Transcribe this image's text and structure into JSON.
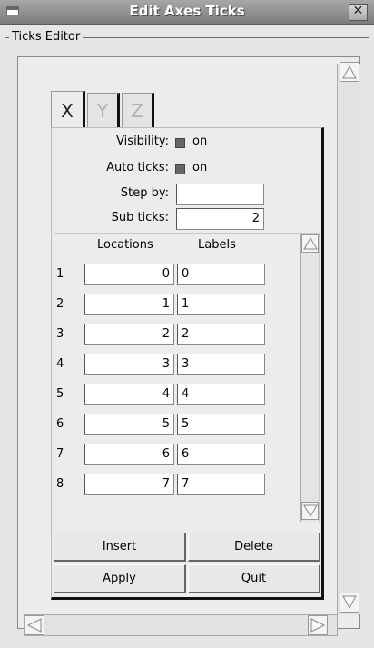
{
  "window": {
    "title": "Edit Axes Ticks",
    "close_glyph": "✕"
  },
  "frame": {
    "legend": "Ticks Editor"
  },
  "tabs": [
    {
      "label": "X",
      "active": true
    },
    {
      "label": "Y",
      "active": false
    },
    {
      "label": "Z",
      "active": false
    }
  ],
  "settings": {
    "visibility_label": "Visibility:",
    "visibility_value": "on",
    "auto_ticks_label": "Auto ticks:",
    "auto_ticks_value": "on",
    "step_by_label": "Step by:",
    "step_by_value": "",
    "sub_ticks_label": "Sub ticks:",
    "sub_ticks_value": "2"
  },
  "table": {
    "headers": {
      "locations": "Locations",
      "labels": "Labels"
    },
    "rows": [
      {
        "index": "1",
        "location": "0",
        "label": "0"
      },
      {
        "index": "2",
        "location": "1",
        "label": "1"
      },
      {
        "index": "3",
        "location": "2",
        "label": "2"
      },
      {
        "index": "4",
        "location": "3",
        "label": "3"
      },
      {
        "index": "5",
        "location": "4",
        "label": "4"
      },
      {
        "index": "6",
        "location": "5",
        "label": "5"
      },
      {
        "index": "7",
        "location": "6",
        "label": "6"
      },
      {
        "index": "8",
        "location": "7",
        "label": "7"
      }
    ]
  },
  "buttons": {
    "insert": "Insert",
    "delete": "Delete",
    "apply": "Apply",
    "quit": "Quit"
  }
}
